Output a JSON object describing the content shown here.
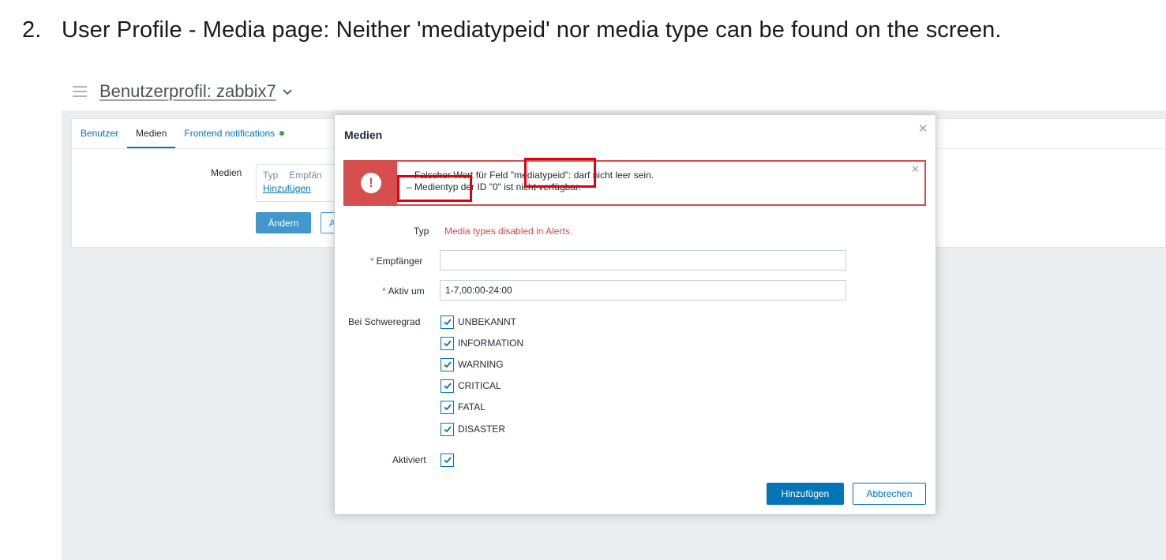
{
  "caption": {
    "number": "2.",
    "text": "User Profile - Media page: Neither 'mediatypeid' nor media type can be found on the screen."
  },
  "page": {
    "title": "Benutzerprofil: zabbix7"
  },
  "tabs": [
    {
      "label": "Benutzer",
      "active": false
    },
    {
      "label": "Medien",
      "active": true
    },
    {
      "label": "Frontend notifications",
      "active": false
    }
  ],
  "profile_form": {
    "media_label": "Medien",
    "table_headers": [
      "Typ",
      "Empfän"
    ],
    "add_link": "Hinzufügen",
    "update_button": "Ändern",
    "cancel_button_partial": "A"
  },
  "modal": {
    "title": "Medien",
    "error_messages": [
      "– Falscher Wert für Feld \"mediatypeid\": darf nicht leer sein.",
      "– Medientyp der ID \"0\" ist nicht verfügbar."
    ],
    "fields": {
      "type_label": "Typ",
      "type_value": "Media types disabled in Alerts.",
      "recipient_label": "Empfänger",
      "recipient_value": "",
      "active_label": "Aktiv um",
      "active_value": "1-7,00:00-24:00",
      "severity_label": "Bei Schweregrad",
      "enabled_label": "Aktiviert"
    },
    "severities": [
      {
        "label": "UNBEKANNT",
        "checked": true
      },
      {
        "label": "INFORMATION",
        "checked": true
      },
      {
        "label": "WARNING",
        "checked": true
      },
      {
        "label": "CRITICAL",
        "checked": true
      },
      {
        "label": "FATAL",
        "checked": true
      },
      {
        "label": "DISASTER",
        "checked": true
      }
    ],
    "enabled_checked": true,
    "buttons": {
      "add": "Hinzufügen",
      "cancel": "Abbrechen"
    }
  },
  "colors": {
    "accent": "#0275b8",
    "error": "#d64e4e",
    "highlight": "#e1000f"
  }
}
